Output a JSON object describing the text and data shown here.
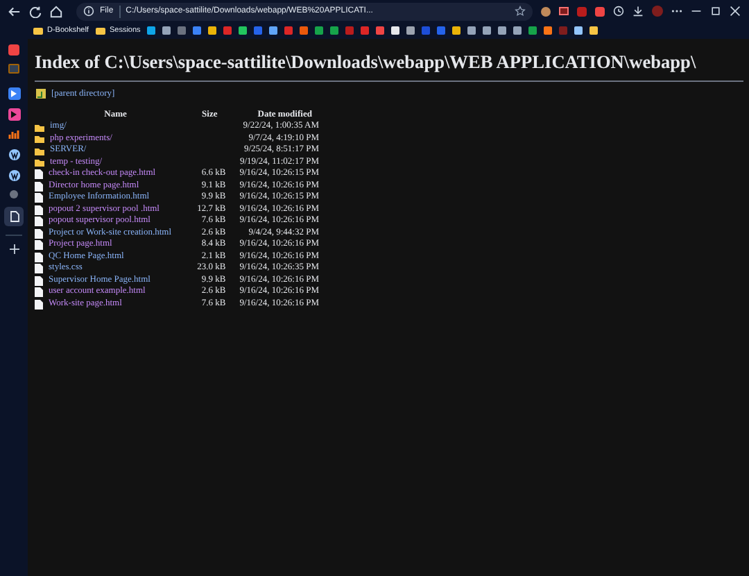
{
  "address_bar": {
    "scheme_label": "File",
    "url": "C:/Users/space-sattilite/Downloads/webapp/WEB%20APPLICATI..."
  },
  "bookmarks": [
    {
      "label": "D-Bookshelf"
    },
    {
      "label": "Sessions"
    }
  ],
  "page": {
    "title": "Index of C:\\Users\\space-sattilite\\Downloads\\webapp\\WEB APPLICATION\\webapp\\",
    "parent_link": "[parent directory]",
    "columns": [
      "Name",
      "Size",
      "Date modified"
    ],
    "rows": [
      {
        "kind": "folder",
        "name": "img/",
        "size": "",
        "date": "9/22/24, 1:00:35 AM",
        "visited": false
      },
      {
        "kind": "folder",
        "name": "php experiments/",
        "size": "",
        "date": "9/7/24, 4:19:10 PM",
        "visited": true
      },
      {
        "kind": "folder",
        "name": "SERVER/",
        "size": "",
        "date": "9/25/24, 8:51:17 PM",
        "visited": false
      },
      {
        "kind": "folder",
        "name": "temp - testing/",
        "size": "",
        "date": "9/19/24, 11:02:17 PM",
        "visited": true
      },
      {
        "kind": "file",
        "name": "check-in check-out page.html",
        "size": "6.6 kB",
        "date": "9/16/24, 10:26:15 PM",
        "visited": true
      },
      {
        "kind": "file",
        "name": "Director home page.html",
        "size": "9.1 kB",
        "date": "9/16/24, 10:26:16 PM",
        "visited": true
      },
      {
        "kind": "file",
        "name": "Employee Information.html",
        "size": "9.9 kB",
        "date": "9/16/24, 10:26:15 PM",
        "visited": false
      },
      {
        "kind": "file",
        "name": "popout 2 supervisor pool .html",
        "size": "12.7 kB",
        "date": "9/16/24, 10:26:16 PM",
        "visited": true
      },
      {
        "kind": "file",
        "name": "popout supervisor pool.html",
        "size": "7.6 kB",
        "date": "9/16/24, 10:26:16 PM",
        "visited": true
      },
      {
        "kind": "file",
        "name": "Project or Work-site creation.html",
        "size": "2.6 kB",
        "date": "9/4/24, 9:44:32 PM",
        "visited": false
      },
      {
        "kind": "file",
        "name": "Project page.html",
        "size": "8.4 kB",
        "date": "9/16/24, 10:26:16 PM",
        "visited": true
      },
      {
        "kind": "file",
        "name": "QC Home Page.html",
        "size": "2.1 kB",
        "date": "9/16/24, 10:26:16 PM",
        "visited": false
      },
      {
        "kind": "file",
        "name": "styles.css",
        "size": "23.0 kB",
        "date": "9/16/24, 10:26:35 PM",
        "visited": false
      },
      {
        "kind": "file",
        "name": "Supervisor Home Page.html",
        "size": "9.9 kB",
        "date": "9/16/24, 10:26:16 PM",
        "visited": false
      },
      {
        "kind": "file",
        "name": "user account example.html",
        "size": "2.6 kB",
        "date": "9/16/24, 10:26:16 PM",
        "visited": true
      },
      {
        "kind": "file",
        "name": "Work-site page.html",
        "size": "7.6 kB",
        "date": "9/16/24, 10:26:16 PM",
        "visited": true
      }
    ]
  }
}
